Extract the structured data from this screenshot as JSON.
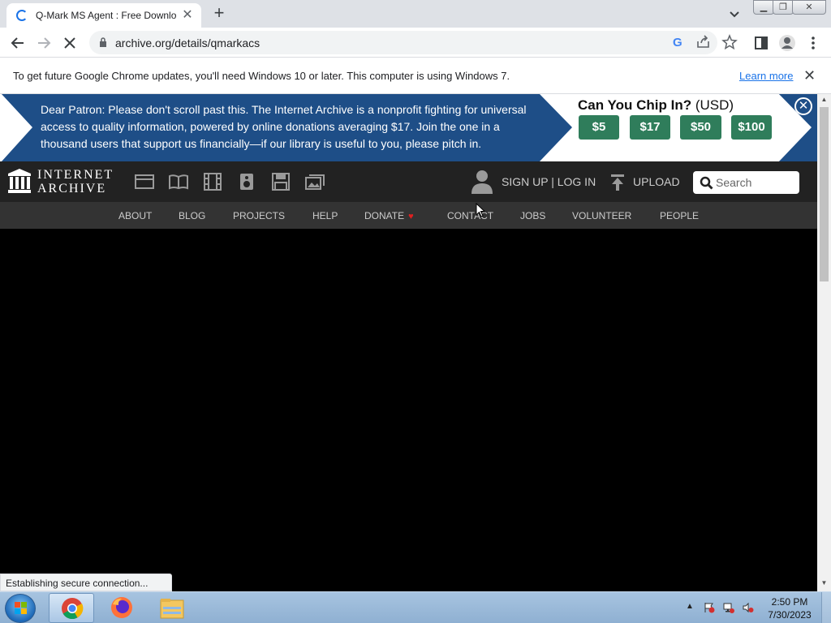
{
  "browser": {
    "tab": {
      "title": "Q-Mark MS Agent : Free Downlo",
      "close": "✕"
    },
    "new_tab": "+",
    "url": "archive.org/details/qmarkacs",
    "infobar": {
      "text": "To get future Google Chrome updates, you'll need Windows 10 or later. This computer is using Windows 7.",
      "link": "Learn more",
      "close": "✕"
    },
    "status": "Establishing secure connection..."
  },
  "page": {
    "banner": {
      "text": "Dear Patron: Please don't scroll past this. The Internet Archive is a nonprofit fighting for universal access to quality information, powered by online donations averaging $17. Join the one in a thousand users that support us financially—if our library is useful to you, please pitch in.",
      "chip_title": "Can You Chip In?",
      "chip_currency": "(USD)",
      "amounts": [
        "$5",
        "$17",
        "$50",
        "$100"
      ],
      "close": "✕"
    },
    "header": {
      "logo_line1": "INTERNET",
      "logo_line2": "ARCHIVE",
      "signup": "SIGN UP | LOG IN",
      "upload": "UPLOAD",
      "search_placeholder": "Search"
    },
    "nav": [
      "ABOUT",
      "BLOG",
      "PROJECTS",
      "HELP",
      "DONATE",
      "CONTACT",
      "JOBS",
      "VOLUNTEER",
      "PEOPLE"
    ]
  },
  "taskbar": {
    "time": "2:50 PM",
    "date": "7/30/2023"
  },
  "colors": {
    "banner": "#1e4e87",
    "chip_button": "#2f7d5b",
    "ia_header": "#222222",
    "ia_nav": "#333333",
    "donate_heart": "#e02020"
  }
}
